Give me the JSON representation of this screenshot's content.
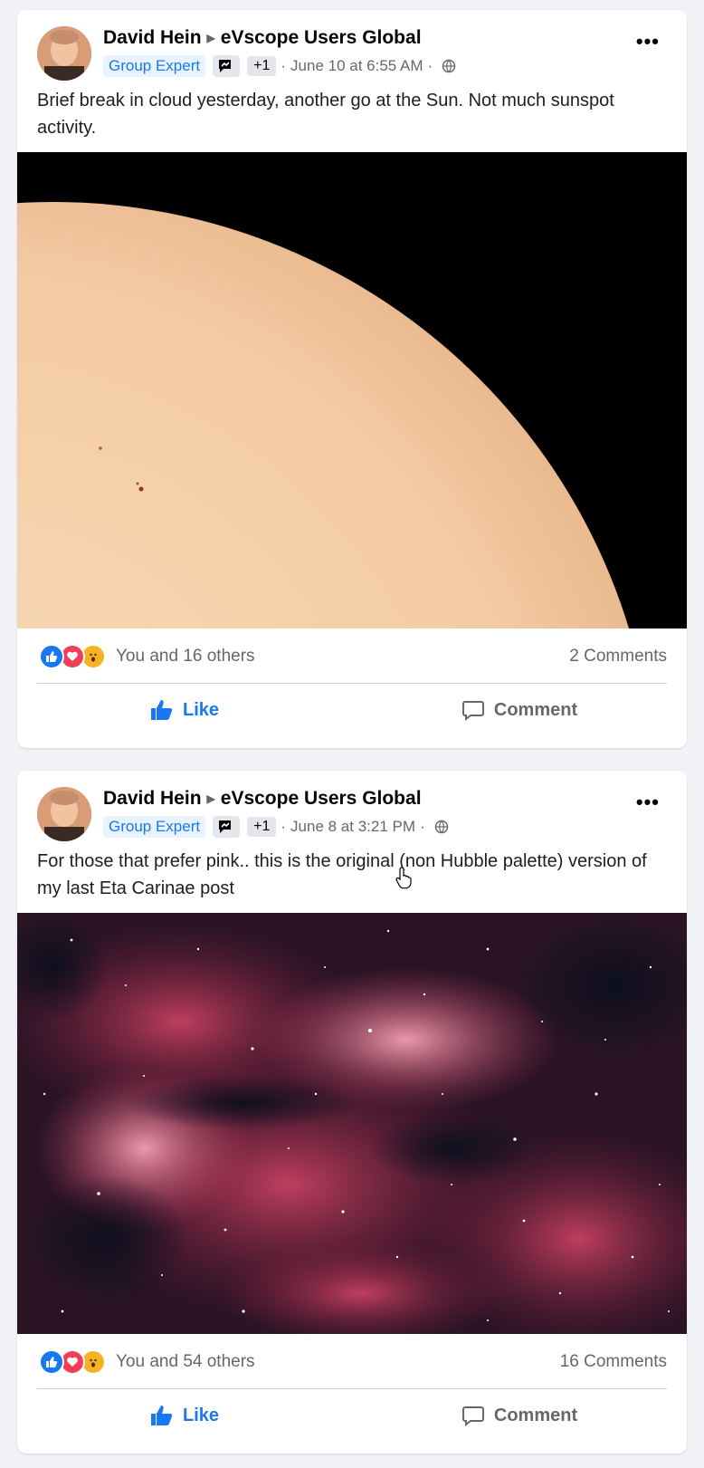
{
  "posts": [
    {
      "author": "David Hein",
      "group": "eVscope Users Global",
      "badge": "Group Expert",
      "extra_badges": "+1",
      "timestamp": "June 10 at 6:55 AM",
      "text": "Brief break in cloud yesterday, another go at the Sun. Not much sunspot activity.",
      "reactions_text": "You and 16 others",
      "comments_text": "2 Comments",
      "like_label": "Like",
      "comment_label": "Comment"
    },
    {
      "author": "David Hein",
      "group": "eVscope Users Global",
      "badge": "Group Expert",
      "extra_badges": "+1",
      "timestamp": "June 8 at 3:21 PM",
      "text": "For those that prefer pink.. this is the original (non Hubble palette) version of my last Eta Carinae post",
      "reactions_text": "You and 54 others",
      "comments_text": "16 Comments",
      "like_label": "Like",
      "comment_label": "Comment"
    }
  ],
  "separator": "·",
  "icons": {
    "more": "more-options-icon",
    "audience": "globe-icon",
    "like": "thumbs-up-icon",
    "comment": "comment-bubble-icon"
  },
  "colors": {
    "accent": "#1877f2",
    "love": "#f33e58",
    "wow": "#f7b125"
  }
}
